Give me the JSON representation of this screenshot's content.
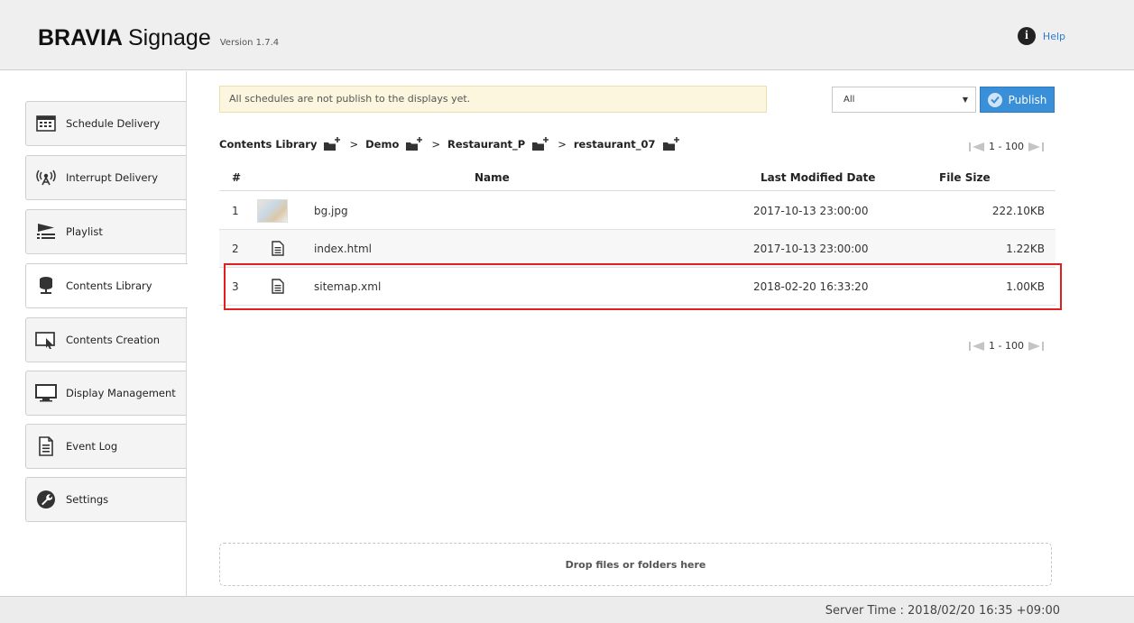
{
  "header": {
    "brand_bold": "BRAVIA",
    "brand_light": "Signage",
    "version": "Version 1.7.4",
    "help_label": "Help",
    "help_icon": "info-icon"
  },
  "sidebar": {
    "items": [
      {
        "label": "Schedule Delivery",
        "icon": "calendar-icon"
      },
      {
        "label": "Interrupt Delivery",
        "icon": "broadcast-icon"
      },
      {
        "label": "Playlist",
        "icon": "playlist-icon"
      },
      {
        "label": "Contents Library",
        "icon": "library-icon",
        "active": true
      },
      {
        "label": "Contents Creation",
        "icon": "creation-icon"
      },
      {
        "label": "Display Management",
        "icon": "monitor-icon"
      },
      {
        "label": "Event Log",
        "icon": "document-icon"
      },
      {
        "label": "Settings",
        "icon": "wrench-icon"
      }
    ]
  },
  "notice": {
    "text": "All schedules are not publish to the displays yet."
  },
  "filter": {
    "selected": "All"
  },
  "publish": {
    "label": "Publish"
  },
  "breadcrumb": {
    "items": [
      "Contents Library",
      "Demo",
      "Restaurant_P",
      "restaurant_07"
    ],
    "separator": ">"
  },
  "pager": {
    "range": "1 - 100"
  },
  "table": {
    "columns": {
      "num": "#",
      "name": "Name",
      "date": "Last Modified Date",
      "size": "File Size"
    },
    "rows": [
      {
        "num": "1",
        "name": "bg.jpg",
        "date": "2017-10-13 23:00:00",
        "size": "222.10KB",
        "kind": "image"
      },
      {
        "num": "2",
        "name": "index.html",
        "date": "2017-10-13 23:00:00",
        "size": "1.22KB",
        "kind": "file"
      },
      {
        "num": "3",
        "name": "sitemap.xml",
        "date": "2018-02-20 16:33:20",
        "size": "1.00KB",
        "kind": "file"
      }
    ]
  },
  "dropzone": {
    "text": "Drop files or folders here"
  },
  "footer": {
    "server_time": "Server Time : 2018/02/20 16:35 +09:00"
  },
  "colors": {
    "accent": "#3a8fd9",
    "highlight": "#e02020",
    "notice_bg": "#fcf6df"
  }
}
